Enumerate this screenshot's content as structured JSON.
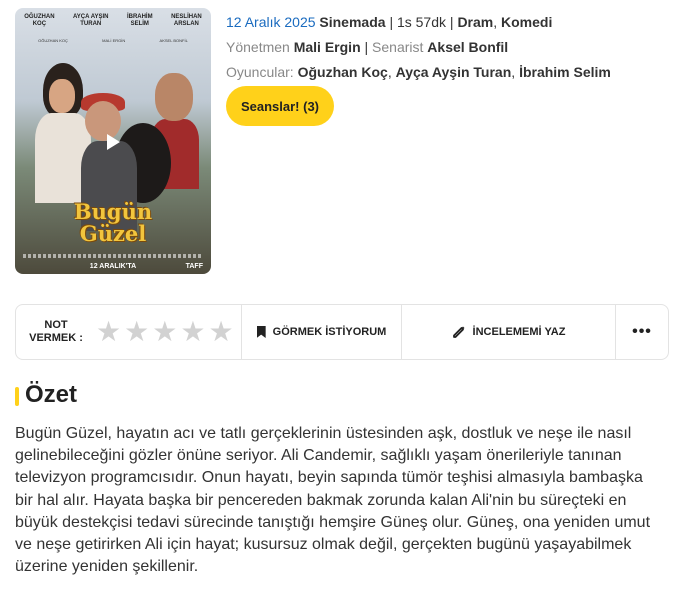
{
  "poster": {
    "cast": [
      "OĞUZHAN\nKOÇ",
      "AYÇA AYŞIN\nTURAN",
      "İBRAHİM\nSELİM",
      "NESLİHAN\nARSLAN"
    ],
    "credits": [
      "OĞUZHAN KOÇ",
      "MALİ ERGİN",
      "AKSEL BONFİL"
    ],
    "title": "Bugün\nGüzel",
    "date": "12 ARALIK'TA",
    "logo": "TAFF"
  },
  "info": {
    "release_date": "12 Aralık 2025",
    "status": "Sinemada",
    "duration": "1s 57dk",
    "genres": [
      "Dram",
      "Komedi"
    ],
    "director_label": "Yönetmen",
    "director": "Mali Ergin",
    "writer_label": "Senarist",
    "writer": "Aksel Bonfil",
    "cast_label": "Oyuncular:",
    "cast": [
      "Oğuzhan Koç",
      "Ayça Ayşin Turan",
      "İbrahim Selim"
    ]
  },
  "seanslar_button": "Seanslar! (3)",
  "actionbar": {
    "rate_label": "NOT\nVERMEK :",
    "stars": [
      "★",
      "★",
      "★",
      "★",
      "★"
    ],
    "watch_label": "GÖRMEK İSTİYORUM",
    "review_label": "İNCELEMEMİ YAZ",
    "more_label": "•••"
  },
  "summary": {
    "title": "Özet",
    "text": "Bugün Güzel, hayatın acı ve tatlı gerçeklerinin üstesinden aşk, dostluk ve neşe ile nasıl gelinebileceğini gözler önüne seriyor. Ali Candemir, sağlıklı yaşam önerileriyle tanınan televizyon programcısıdır. Onun hayatı, beyin sapında tümör teşhisi almasıyla bambaşka bir hal alır. Hayata başka bir pencereden bakmak zorunda kalan Ali'nin bu süreçteki en büyük destekçisi tedavi sürecinde tanıştığı hemşire Güneş olur. Güneş, ona yeniden umut ve neşe getirirken Ali için hayat; kusursuz olmak değil, gerçekten bugünü yaşayabilmek üzerine yeniden şekillenir."
  },
  "colors": {
    "accent": "#ffd11a",
    "link_blue": "#1a6bbf",
    "star_empty": "#d2d2d2"
  }
}
